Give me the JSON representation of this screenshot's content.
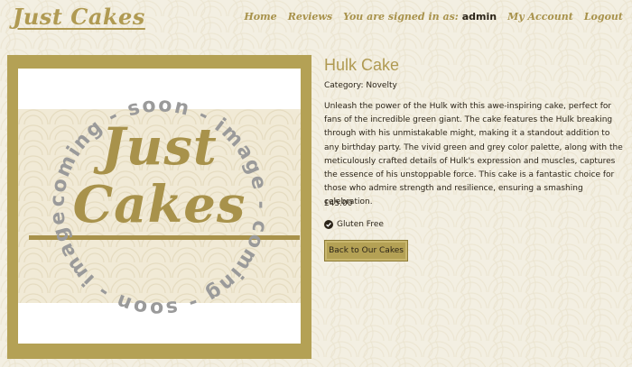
{
  "header": {
    "brand": "Just Cakes",
    "nav": {
      "home": "Home",
      "reviews": "Reviews",
      "signed_in_label": "You are signed in as:",
      "username": "admin",
      "account": "My Account",
      "logout": "Logout"
    }
  },
  "image": {
    "logo_text": "Just Cakes",
    "stamp_text": "coming - soon - image - coming - soon - image - "
  },
  "product": {
    "title": "Hulk Cake",
    "category": "Category: Novelty",
    "description": "Unleash the power of the Hulk with this awe-inspiring cake, perfect for fans of the incredible green giant. The cake features the Hulk breaking through with his unmistakable might, making it a standout addition to any birthday party. The vivid green and grey color palette, along with the meticulously crafted details of Hulk's expression and muscles, captures the essence of his unstoppable force. This cake is a fantastic choice for those who admire strength and resilience, ensuring a smashing celebration.",
    "price": "£45.00",
    "dietary": "Gluten Free",
    "back_button": "Back to Our Cakes"
  },
  "colors": {
    "brand": "#b09a52",
    "card": "#b4a155",
    "background": "#f3efe2"
  }
}
